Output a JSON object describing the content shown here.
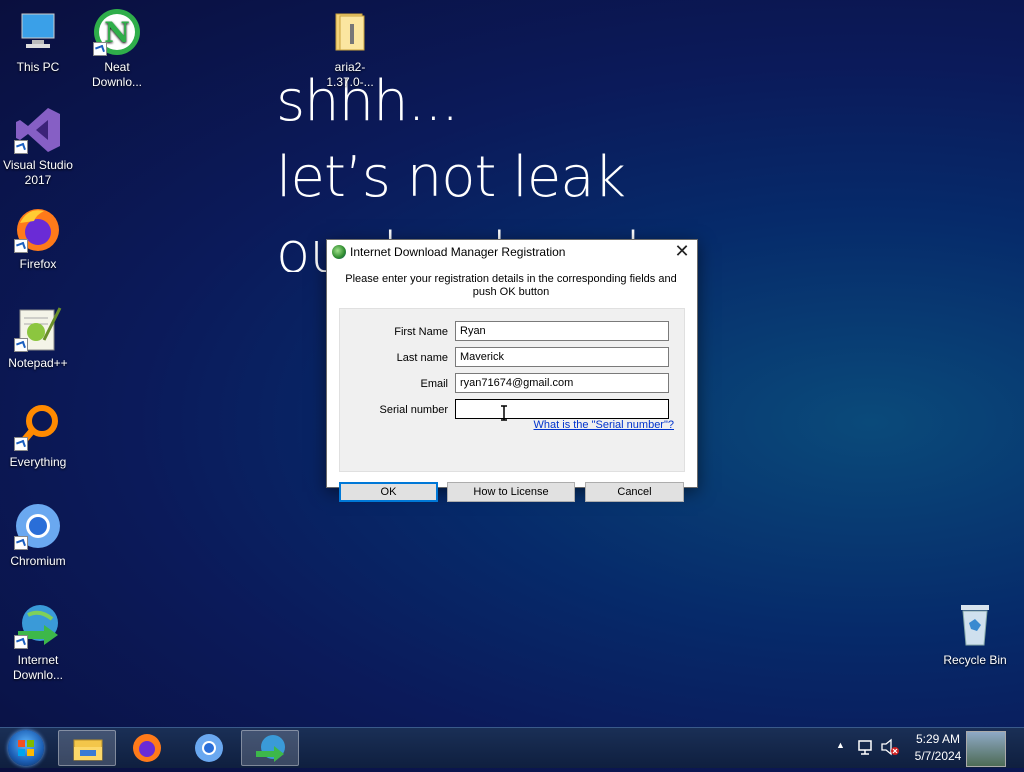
{
  "wallpaper": {
    "lines": [
      "shhh...",
      "let’s not leak",
      "our hard work"
    ]
  },
  "desktop_icons": [
    {
      "label": "This PC"
    },
    {
      "label": "Neat Downlo..."
    },
    {
      "label": "aria2-1.37.0-..."
    },
    {
      "label": "Visual Studio 2017"
    },
    {
      "label": "Firefox"
    },
    {
      "label": "Notepad++"
    },
    {
      "label": "Everything"
    },
    {
      "label": "Chromium"
    },
    {
      "label": "Internet Downlo..."
    },
    {
      "label": "Recycle Bin"
    }
  ],
  "dialog": {
    "title": "Internet Download Manager Registration",
    "intro": "Please enter your registration details in the corresponding fields and push OK button",
    "fields": {
      "first_name": {
        "label": "First Name",
        "value": "Ryan"
      },
      "last_name": {
        "label": "Last name",
        "value": "Maverick"
      },
      "email": {
        "label": "Email",
        "value": "ryan71674@gmail.com"
      },
      "serial": {
        "label": "Serial number",
        "value": ""
      }
    },
    "serial_link": "What is the \"Serial number\"?",
    "buttons": {
      "ok": "OK",
      "how_to": "How to License",
      "cancel": "Cancel"
    },
    "close_glyph": "✕"
  },
  "taskbar": {
    "clock_time": "5:29 AM",
    "clock_date": "5/7/2024",
    "tray_up_glyph": "▲"
  },
  "colors": {
    "accent": "#0078d7",
    "link": "#0033cc"
  }
}
